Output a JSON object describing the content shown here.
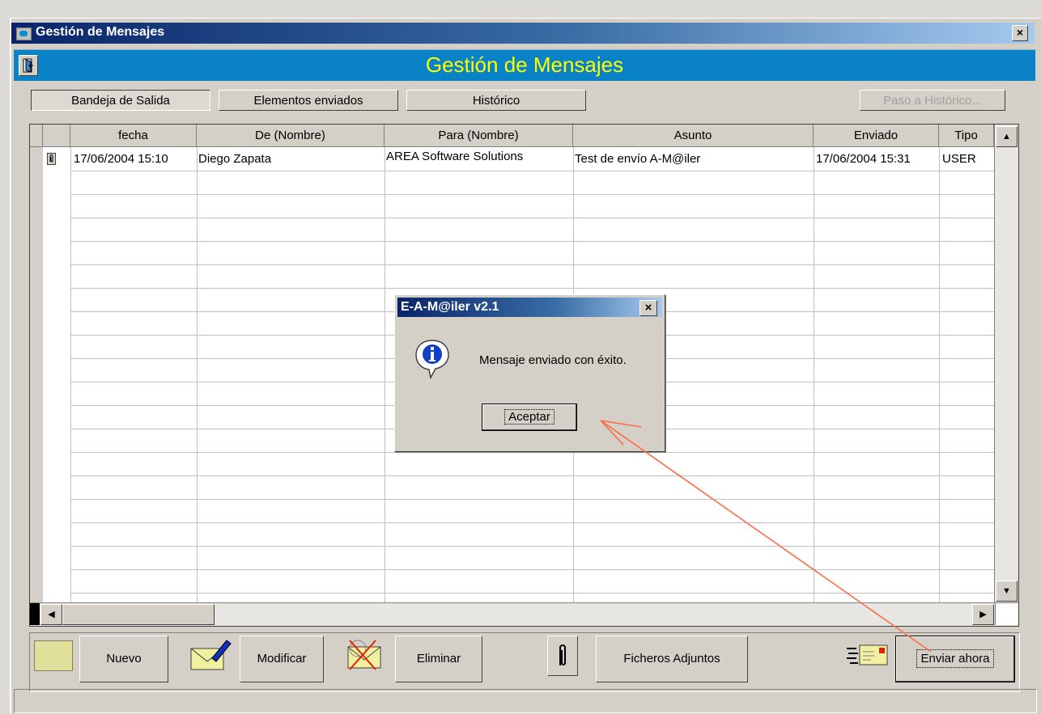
{
  "window": {
    "title": "Gestión de Mensajes",
    "close_label": "×"
  },
  "banner": {
    "title": "Gestión de Mensajes"
  },
  "tabs": [
    {
      "label": "Bandeja de Salida",
      "active": true
    },
    {
      "label": "Elementos enviados",
      "active": false
    },
    {
      "label": "Histórico",
      "active": false
    }
  ],
  "paso_historico": {
    "label": "Paso a Histórico...",
    "enabled": false
  },
  "table": {
    "columns": [
      "fecha",
      "De (Nombre)",
      "Para (Nombre)",
      "Asunto",
      "Enviado",
      "Tipo"
    ],
    "rows": [
      {
        "fecha": "17/06/2004 15:10",
        "de": "Diego Zapata",
        "para": "AREA Software Solutions",
        "asunto": "Test de envío A-M@iler",
        "enviado": "17/06/2004 15:31",
        "tipo": "USER",
        "attachment_icon": "paperclip-icon"
      }
    ]
  },
  "toolbar": {
    "nuevo": "Nuevo",
    "modificar": "Modificar",
    "eliminar": "Eliminar",
    "ficheros": "Ficheros Adjuntos",
    "enviar": "Enviar ahora"
  },
  "dialog": {
    "title": "E-A-M@iler v2.1",
    "message": "Mensaje enviado con éxito.",
    "ok_label": "Aceptar",
    "close_label": "×",
    "icon": "info-icon"
  },
  "colors": {
    "titlebar": "#0a246a",
    "banner": "#0a82c8",
    "banner_text": "#ffff00",
    "annotation_arrow": "#ff6a4a"
  }
}
